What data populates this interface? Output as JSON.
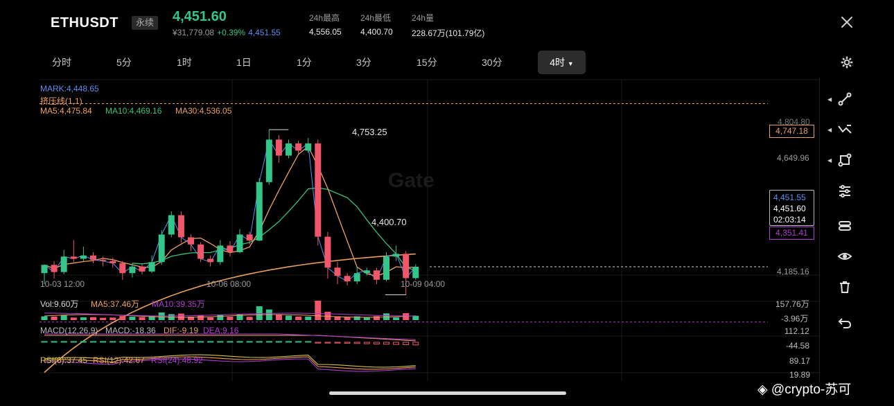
{
  "header": {
    "symbol": "ETHUSDT",
    "contract_type": "永续",
    "last_price": "4,451.60",
    "cny_price": "¥31,779.08",
    "change_pct": "+0.39%",
    "mark_price": "4,451.55",
    "stats": [
      {
        "label": "24h最高",
        "value": "4,556.05"
      },
      {
        "label": "24h最低",
        "value": "4,400.70"
      },
      {
        "label": "24h量",
        "value": "228.67万(101.79亿)"
      }
    ]
  },
  "tabs": [
    "分时",
    "5分",
    "1时",
    "1日",
    "1分",
    "3分",
    "15分",
    "30分"
  ],
  "active_tab": "4时",
  "indicators": {
    "mark": "MARK:4,448.65",
    "squeeze": "挤压线(1,1)",
    "ma5": "MA5:4,475.84",
    "ma10": "MA10:4,469.16",
    "ma30": "MA30:4,536.05",
    "vol": "Vol:9.60万",
    "vol_ma5": "MA5:37.46万",
    "vol_ma10": "MA10:39.35万",
    "macd": "MACD(12,26,9)",
    "macd_val": "MACD:-18.36",
    "dif": "DIF:-9.19",
    "dea": "DEA:9.16",
    "rsi6": "RSI(6):37.45",
    "rsi12": "RSI(12):42.67",
    "rsi24": "RSI(24):48.92"
  },
  "price_axis": {
    "top": "4,804.80",
    "upper_line": "4,747.18",
    "mid": "4,649.96",
    "mark_box": "4,451.55",
    "last_box": "4,451.60",
    "countdown": "02:03:14",
    "lower_line": "4,351.41",
    "bottom": "4,185.16",
    "high_marker": "4,753.25",
    "low_marker": "4,400.70"
  },
  "time_axis": [
    "10-03 12:00",
    "10-06 08:00",
    "10-09 04:00"
  ],
  "sub_axes": {
    "vol_top": "157.76万",
    "vol_bottom": "-3.96万",
    "macd_top": "112.12",
    "macd_bottom": "-44.58",
    "rsi_top": "89.17",
    "rsi_bottom": "19.89"
  },
  "watermark": "@crypto-苏可",
  "toolbar": [
    "trendline-icon",
    "indicator-icon",
    "drawing-icon",
    "settings-sliders-icon",
    "layers-icon",
    "eye-icon",
    "trash-icon",
    "undo-icon"
  ],
  "colors": {
    "up": "#33c58a",
    "down": "#f0576b",
    "ma5": "#f2a15b",
    "ma10": "#35c27a",
    "ma30": "#e8a05c",
    "mark": "#5b8df0",
    "purple": "#b23bd2"
  },
  "watermark_logo": "Gate",
  "chart_data": {
    "type": "candlestick",
    "interval": "4h",
    "ylim": [
      4185.16,
      4804.8
    ],
    "candles": [
      [
        4440,
        4455,
        4455,
        4420
      ],
      [
        4455,
        4442,
        4462,
        4430
      ],
      [
        4442,
        4470,
        4482,
        4438
      ],
      [
        4470,
        4466,
        4500,
        4460
      ],
      [
        4466,
        4472,
        4488,
        4462
      ],
      [
        4472,
        4464,
        4478,
        4458
      ],
      [
        4464,
        4462,
        4470,
        4452
      ],
      [
        4462,
        4458,
        4468,
        4450
      ],
      [
        4458,
        4440,
        4462,
        4428
      ],
      [
        4440,
        4452,
        4458,
        4432
      ],
      [
        4452,
        4443,
        4456,
        4438
      ],
      [
        4443,
        4460,
        4472,
        4440
      ],
      [
        4460,
        4510,
        4518,
        4455
      ],
      [
        4510,
        4545,
        4552,
        4505
      ],
      [
        4545,
        4505,
        4552,
        4495
      ],
      [
        4505,
        4492,
        4510,
        4480
      ],
      [
        4492,
        4466,
        4496,
        4460
      ],
      [
        4466,
        4460,
        4472,
        4452
      ],
      [
        4460,
        4490,
        4500,
        4455
      ],
      [
        4490,
        4478,
        4498,
        4470
      ],
      [
        4478,
        4510,
        4520,
        4476
      ],
      [
        4510,
        4499,
        4515,
        4492
      ],
      [
        4499,
        4605,
        4612,
        4498
      ],
      [
        4605,
        4682,
        4700,
        4600
      ],
      [
        4682,
        4653,
        4690,
        4640
      ],
      [
        4653,
        4675,
        4682,
        4648
      ],
      [
        4675,
        4662,
        4680,
        4655
      ],
      [
        4662,
        4675,
        4685,
        4658
      ],
      [
        4675,
        4506,
        4682,
        4490
      ],
      [
        4506,
        4450,
        4515,
        4430
      ],
      [
        4450,
        4435,
        4460,
        4420
      ],
      [
        4435,
        4425,
        4440,
        4418
      ],
      [
        4425,
        4440,
        4452,
        4420
      ],
      [
        4440,
        4445,
        4450,
        4436
      ],
      [
        4445,
        4428,
        4450,
        4420
      ],
      [
        4428,
        4470,
        4478,
        4425
      ],
      [
        4470,
        4475,
        4490,
        4462
      ],
      [
        4475,
        4431,
        4480,
        4400.7
      ],
      [
        4431,
        4451.6,
        4456,
        4428
      ]
    ]
  }
}
